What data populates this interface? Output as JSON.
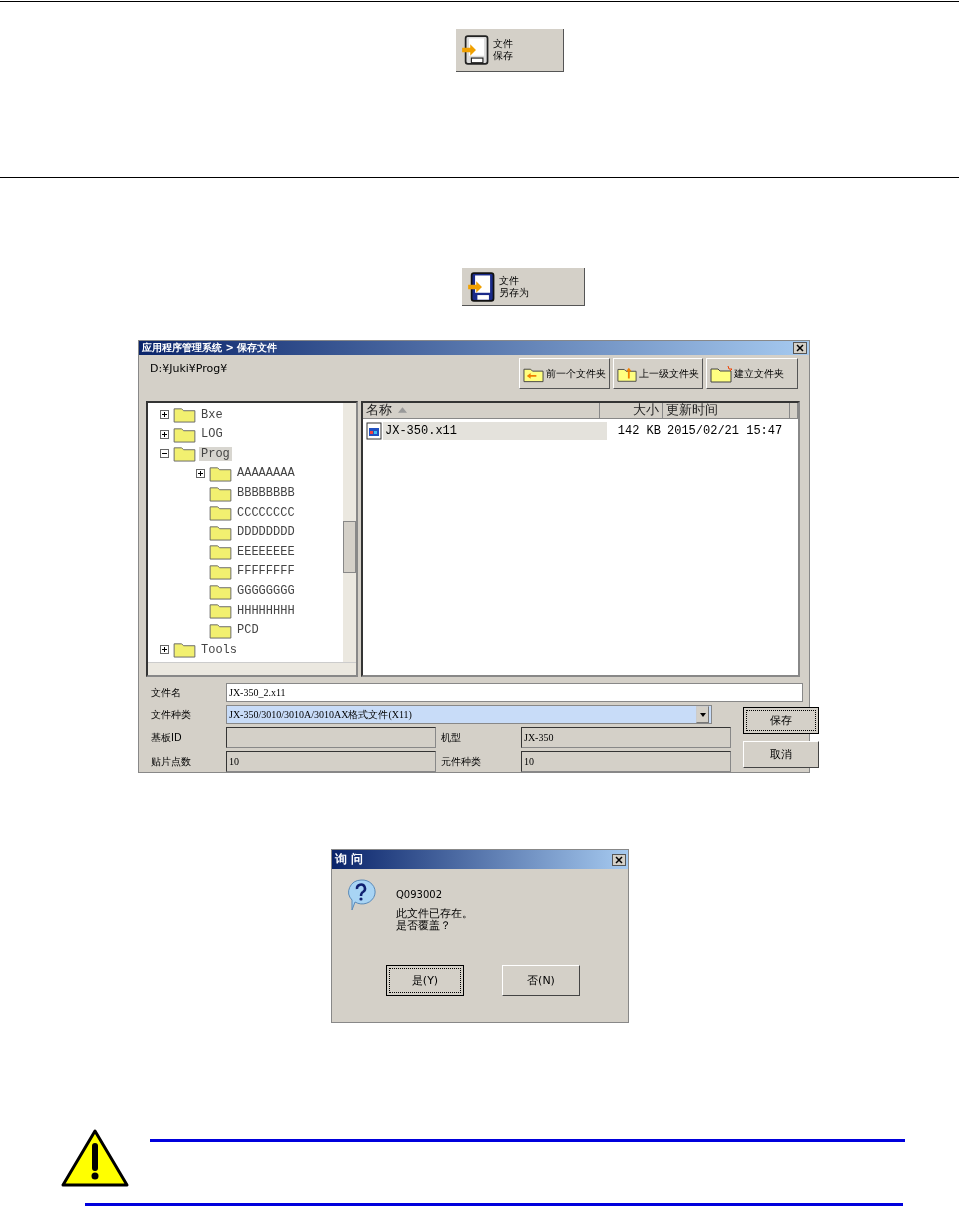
{
  "save_button": {
    "label": [
      "文件",
      "保存"
    ]
  },
  "save_as_button": {
    "label": [
      "文件",
      "另存为"
    ]
  },
  "save_dialog": {
    "title": "应用程序管理系统 > 保存文件",
    "path": "D:¥Juki¥Prog¥",
    "toolbar": [
      "前一个文件夹",
      "上一级文件夹",
      "建立文件夹"
    ],
    "tree": [
      {
        "label": "Bxe",
        "expanded": false,
        "selected": false
      },
      {
        "label": "LOG",
        "expanded": false,
        "selected": false
      },
      {
        "label": "Prog",
        "expanded": true,
        "selected": true,
        "children": [
          {
            "label": "AAAAAAAA",
            "expanded": false,
            "selected": false
          },
          {
            "label": "BBBBBBBB",
            "selected": false
          },
          {
            "label": "CCCCCCCC",
            "selected": false
          },
          {
            "label": "DDDDDDDD",
            "selected": false
          },
          {
            "label": "EEEEEEEE",
            "selected": false
          },
          {
            "label": "FFFFFFFF",
            "selected": false
          },
          {
            "label": "GGGGGGGG",
            "selected": false
          },
          {
            "label": "HHHHHHHH",
            "selected": false
          },
          {
            "label": "PCD",
            "selected": false
          }
        ]
      },
      {
        "label": "Tools",
        "expanded": false,
        "selected": false
      }
    ],
    "columns": [
      "名称",
      "大小",
      "更新时间"
    ],
    "files": [
      {
        "name": "JX-350.x11",
        "size": "142 KB",
        "modified": "2015/02/21 15:47",
        "selected": true
      }
    ],
    "form": [
      {
        "label": "文件名",
        "value": "JX-350_2.x11"
      },
      {
        "label": "文件种类",
        "value": "JX-350/3010/3010A/3010AX格式文件(X11)"
      },
      {
        "label": "基板ID"
      },
      {
        "label": "机型",
        "value": "JX-350"
      },
      {
        "label": "贴片点数",
        "value": "10"
      },
      {
        "label": "元件种类",
        "value": "10"
      }
    ],
    "buttons": [
      {
        "label": "保存",
        "focused": true
      },
      {
        "label": "取消",
        "focused": false
      }
    ]
  },
  "confirm_dialog": {
    "title": "询 问",
    "code": "Q093002",
    "message": [
      "此文件已存在。",
      "是否覆盖？"
    ],
    "buttons": [
      {
        "label": "是(Y)",
        "focused": true
      },
      {
        "label": "否(N)",
        "focused": false
      }
    ]
  }
}
